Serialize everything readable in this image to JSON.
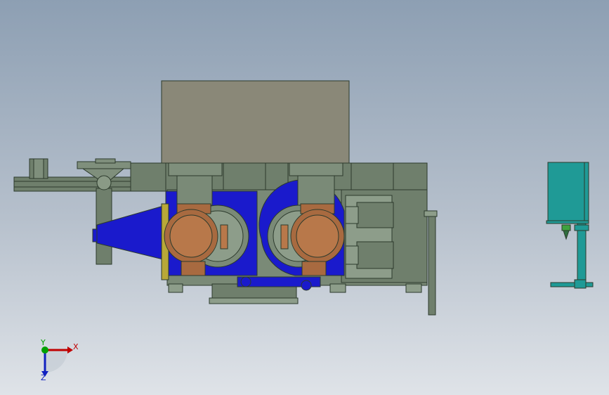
{
  "view": {
    "background_top": "#8d9fb3",
    "background_bottom": "#dfe3e8"
  },
  "triad": {
    "x_label": "X",
    "y_label": "Y",
    "z_label": "Z",
    "x_color": "#c00000",
    "y_color": "#00a000",
    "z_color": "#1020c0"
  },
  "model": {
    "frame_color": "#6f7f6c",
    "hopper_color": "#8a8878",
    "motor_color": "#a86a40",
    "housing_color": "#1a1acc",
    "tank_color": "#1f9a96",
    "icon": "mechanical-assembly-front-view"
  }
}
